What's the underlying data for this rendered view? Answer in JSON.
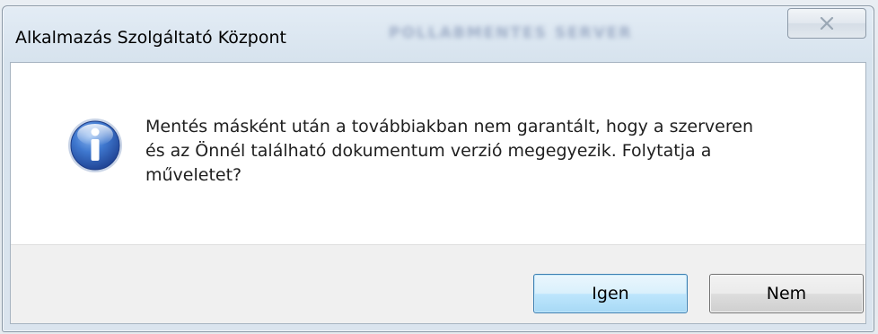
{
  "window": {
    "title": "Alkalmazás Szolgáltató Központ",
    "background_title": "POLLABMENTES SERVER"
  },
  "dialog": {
    "icon": "info-icon",
    "message_lines": [
      "Mentés másként után a továbbiakban nem garantált, hogy a szerveren",
      "és az Önnél található dokumentum verzió megegyezik. Folytatja a",
      "műveletet?"
    ]
  },
  "buttons": {
    "yes_label": "Igen",
    "no_label": "Nem"
  },
  "colors": {
    "icon_blue": "#2a5fb0",
    "default_button_border": "#3c7fb1",
    "footer_bg": "#f0f0f0"
  }
}
